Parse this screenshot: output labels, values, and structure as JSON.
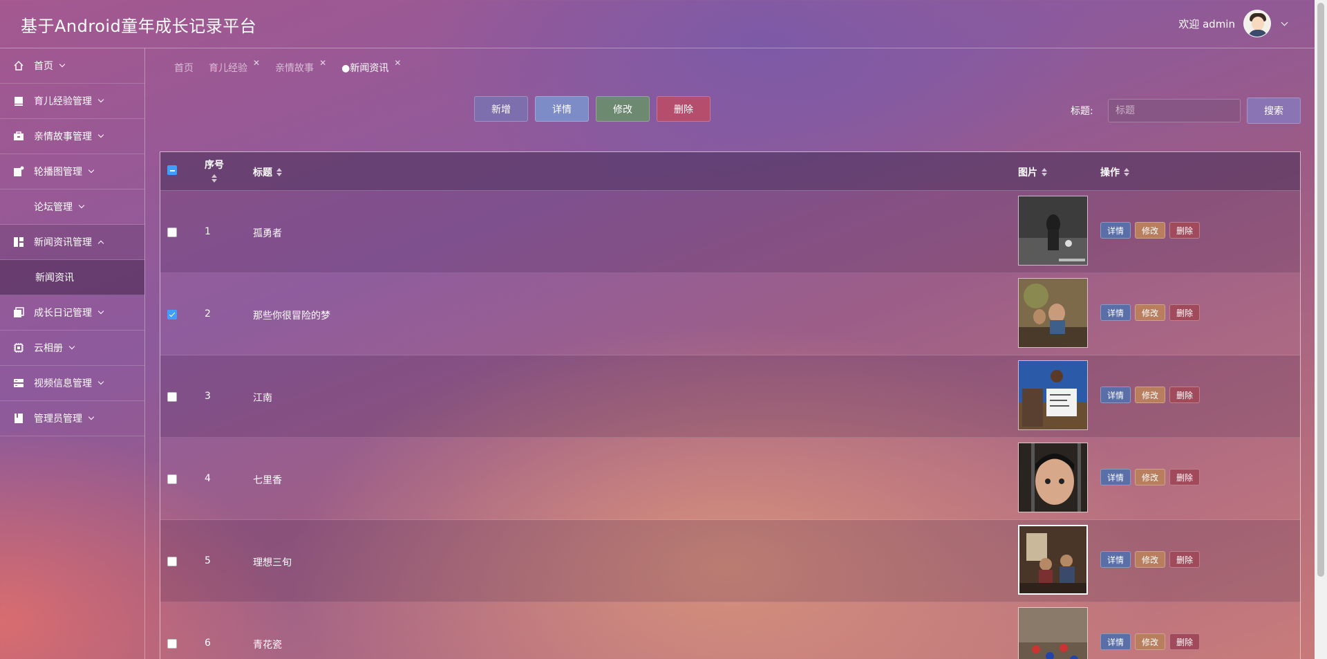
{
  "app": {
    "title": "基于Android童年成长记录平台"
  },
  "user": {
    "welcome": "欢迎 admin"
  },
  "sidebar": {
    "items": [
      {
        "label": "首页",
        "icon": "home-icon"
      },
      {
        "label": "育儿经验管理",
        "icon": "monitor-icon"
      },
      {
        "label": "亲情故事管理",
        "icon": "briefcase-icon"
      },
      {
        "label": "轮播图管理",
        "icon": "image-note-icon"
      },
      {
        "label": "论坛管理",
        "icon": ""
      },
      {
        "label": "新闻资讯管理",
        "icon": "dashboard-icon",
        "expanded": true
      },
      {
        "label": "新闻资讯",
        "sub": true,
        "active": true
      },
      {
        "label": "成长日记管理",
        "icon": "copy-icon"
      },
      {
        "label": "云相册",
        "icon": "chip-icon"
      },
      {
        "label": "视频信息管理",
        "icon": "server-icon"
      },
      {
        "label": "管理员管理",
        "icon": "book-icon"
      }
    ]
  },
  "tabs": [
    {
      "label": "首页",
      "closable": false
    },
    {
      "label": "育儿经验",
      "closable": true
    },
    {
      "label": "亲情故事",
      "closable": true
    },
    {
      "label": "●新闻资讯",
      "closable": true,
      "active": true
    }
  ],
  "toolbar": {
    "add": "新增",
    "detail": "详情",
    "edit": "修改",
    "delete": "删除"
  },
  "search": {
    "label": "标题:",
    "placeholder": "标题",
    "button": "搜索"
  },
  "table": {
    "headers": {
      "index": "序号",
      "title": "标题",
      "image": "图片",
      "actions": "操作"
    },
    "ops": {
      "detail": "详情",
      "edit": "修改",
      "delete": "删除"
    },
    "rows": [
      {
        "index": "1",
        "title": "孤勇者",
        "checked": false
      },
      {
        "index": "2",
        "title": "那些你很冒险的梦",
        "checked": true
      },
      {
        "index": "3",
        "title": "江南",
        "checked": false
      },
      {
        "index": "4",
        "title": "七里香",
        "checked": false
      },
      {
        "index": "5",
        "title": "理想三旬",
        "checked": false
      },
      {
        "index": "6",
        "title": "青花瓷",
        "checked": false
      }
    ]
  },
  "colors": {
    "accent": "#409eff",
    "add_button": "#7d6fad",
    "detail_button": "#7d8cc6",
    "edit_button": "#6d8a71",
    "delete_button": "#b54d6c"
  }
}
